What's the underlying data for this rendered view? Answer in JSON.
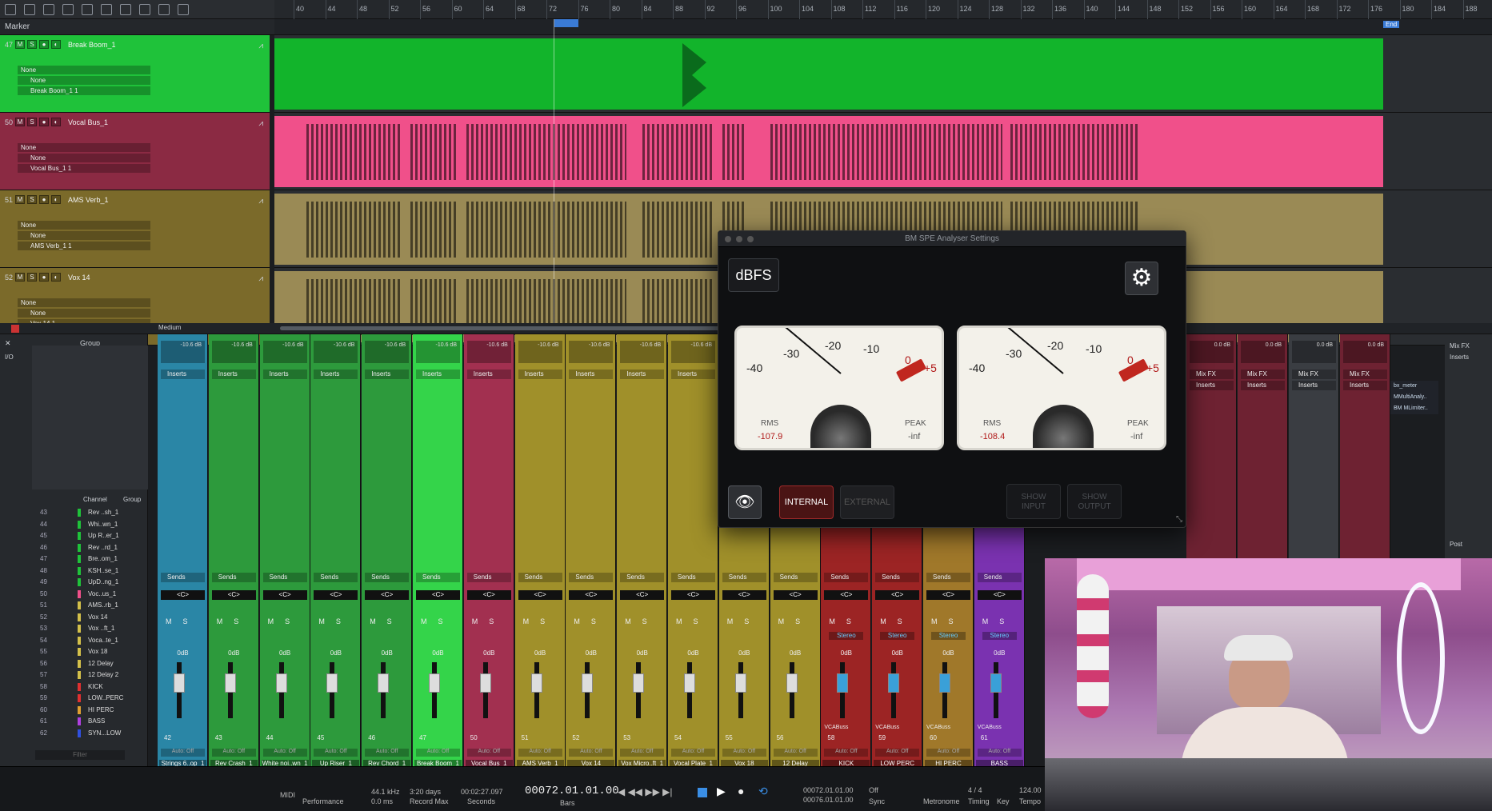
{
  "marker_label": "Marker",
  "ruler_ticks": [
    "40",
    "44",
    "48",
    "52",
    "56",
    "60",
    "64",
    "68",
    "72",
    "76",
    "80",
    "84",
    "88",
    "92",
    "96",
    "100",
    "104",
    "108",
    "112",
    "116",
    "120",
    "124",
    "128",
    "132",
    "136",
    "140",
    "144",
    "148",
    "152",
    "156",
    "160",
    "164",
    "168",
    "172",
    "176",
    "180",
    "184",
    "188"
  ],
  "end_label": "End",
  "tracks": [
    {
      "num": "47",
      "name": "Break Boom_1",
      "f1": "None",
      "f2": "None",
      "f3": "Break Boom_1 1",
      "color": "#1fc23a",
      "lane": "#12b42b"
    },
    {
      "num": "50",
      "name": "Vocal Bus_1",
      "f1": "None",
      "f2": "None",
      "f3": "Vocal Bus_1 1",
      "color": "#8b2a43",
      "lane": "#f0508a"
    },
    {
      "num": "51",
      "name": "AMS Verb_1",
      "f1": "None",
      "f2": "None",
      "f3": "AMS Verb_1 1",
      "color": "#7b6a2a",
      "lane": "#9a8a55"
    },
    {
      "num": "52",
      "name": "Vox 14",
      "f1": "None",
      "f2": "None",
      "f3": "Vox 14 1",
      "color": "#7b6a2a",
      "lane": "#9a8a55"
    }
  ],
  "zoom_label": "Medium",
  "analyser": {
    "title": "BM SPE Analyser Settings",
    "unit_button": "dBFS",
    "scale": [
      "-40",
      "-30",
      "-20",
      "-10",
      "0",
      "+5"
    ],
    "left_meter": {
      "rms_label": "RMS",
      "rms_value": "-107.9",
      "peak_label": "PEAK",
      "peak_value": "-inf"
    },
    "right_meter": {
      "rms_label": "RMS",
      "rms_value": "-108.4",
      "peak_label": "PEAK",
      "peak_value": "-inf"
    },
    "internal": "INTERNAL",
    "external": "EXTERNAL",
    "show_input_1": "SHOW",
    "show_input_2": "INPUT",
    "show_output_1": "SHOW",
    "show_output_2": "OUTPUT"
  },
  "mixer": {
    "group_label": "Group",
    "io_label": "I/O",
    "channel_col": "Channel",
    "group_col": "Group",
    "filter": "Filter",
    "channels": [
      {
        "n": "43",
        "name": "Rev ..sh_1",
        "c": "#1fc23a"
      },
      {
        "n": "44",
        "name": "Whi..wn_1",
        "c": "#1fc23a"
      },
      {
        "n": "45",
        "name": "Up R..er_1",
        "c": "#1fc23a"
      },
      {
        "n": "46",
        "name": "Rev ..rd_1",
        "c": "#1fc23a"
      },
      {
        "n": "47",
        "name": "Bre..om_1",
        "c": "#1fc23a"
      },
      {
        "n": "48",
        "name": "KSH..se_1",
        "c": "#1fc23a"
      },
      {
        "n": "49",
        "name": "UpD..ng_1",
        "c": "#1fc23a"
      },
      {
        "n": "50",
        "name": "Voc..us_1",
        "c": "#f0508a"
      },
      {
        "n": "51",
        "name": "AMS..rb_1",
        "c": "#d4c04a"
      },
      {
        "n": "52",
        "name": "Vox 14",
        "c": "#d4c04a"
      },
      {
        "n": "53",
        "name": "Vox ..ft_1",
        "c": "#d4c04a"
      },
      {
        "n": "54",
        "name": "Voca..te_1",
        "c": "#d4c04a"
      },
      {
        "n": "55",
        "name": "Vox 18",
        "c": "#d4c04a"
      },
      {
        "n": "56",
        "name": "12 Delay",
        "c": "#d4c04a"
      },
      {
        "n": "57",
        "name": "12 Delay 2",
        "c": "#d4c04a"
      },
      {
        "n": "58",
        "name": "KICK",
        "c": "#e03030"
      },
      {
        "n": "59",
        "name": "LOW..PERC",
        "c": "#e03030"
      },
      {
        "n": "60",
        "name": "HI PERC",
        "c": "#e0a030"
      },
      {
        "n": "61",
        "name": "BASS",
        "c": "#b040e0"
      },
      {
        "n": "62",
        "name": "SYN...LOW",
        "c": "#3050e0"
      }
    ],
    "strips": [
      {
        "name": "Strings 6..op_1",
        "num": "42",
        "bg": "#2a86a6",
        "db": "-10.6 dB",
        "v": "0dB"
      },
      {
        "name": "Rev Crash_1",
        "num": "43",
        "bg": "#2d9a3c",
        "db": "-10.6 dB",
        "v": "0dB"
      },
      {
        "name": "White noi..wn_1",
        "num": "44",
        "bg": "#2d9a3c",
        "db": "-10.6 dB",
        "v": "0dB"
      },
      {
        "name": "Up Riser_1",
        "num": "45",
        "bg": "#2d9a3c",
        "db": "-10.6 dB",
        "v": "0dB"
      },
      {
        "name": "Rev Chord_1",
        "num": "46",
        "bg": "#2d9a3c",
        "db": "-10.6 dB",
        "v": "0dB"
      },
      {
        "name": "Break Boom_1",
        "num": "47",
        "bg": "#34d44a",
        "db": "-10.6 dB",
        "v": "0dB"
      },
      {
        "name": "Vocal Bus_1",
        "num": "50",
        "bg": "#a23050",
        "db": "-10.6 dB",
        "v": "0dB"
      },
      {
        "name": "AMS Verb_1",
        "num": "51",
        "bg": "#a0902a",
        "db": "-10.6 dB",
        "v": "0dB"
      },
      {
        "name": "Vox 14",
        "num": "52",
        "bg": "#a0902a",
        "db": "-10.6 dB",
        "v": "0dB"
      },
      {
        "name": "Vox Micro..ft_1",
        "num": "53",
        "bg": "#a0902a",
        "db": "-10.6 dB",
        "v": "0dB"
      },
      {
        "name": "Vocal Plate_1",
        "num": "54",
        "bg": "#a0902a",
        "db": "-10.6 dB",
        "v": "0dB"
      },
      {
        "name": "Vox 18",
        "num": "55",
        "bg": "#a0902a",
        "db": "",
        "v": "0dB"
      },
      {
        "name": "12 Delay",
        "num": "56",
        "bg": "#a0902a",
        "db": "",
        "v": "0dB"
      },
      {
        "name": "KICK",
        "num": "58",
        "bg": "#9c2424",
        "db": "",
        "v": "0dB"
      },
      {
        "name": "LOW PERC",
        "num": "59",
        "bg": "#9c2424",
        "db": "",
        "v": "0dB"
      },
      {
        "name": "HI PERC",
        "num": "60",
        "bg": "#a0782a",
        "db": "",
        "v": "0dB"
      },
      {
        "name": "BASS",
        "num": "61",
        "bg": "#7a32b0",
        "db": "",
        "v": "0dB"
      }
    ],
    "inserts": "Inserts",
    "sends": "Sends",
    "pan": "<C>",
    "auto_off": "Auto: Off",
    "stereo": "Stereo",
    "vcabuss": "VCABuss",
    "right_strips": [
      {
        "db": "0.0 dB",
        "fx": "Mix FX"
      },
      {
        "db": "0.0 dB",
        "fx": "Mix FX"
      },
      {
        "db": "0.0 dB",
        "fx": "Mix FX"
      },
      {
        "db": "0.0 dB",
        "fx": "Mix FX"
      }
    ],
    "plugins": [
      "bx_meter",
      "MMultiAnaly..",
      "BM MLimiter.."
    ],
    "post": "Post"
  },
  "transport": {
    "midi": "MIDI",
    "performance": "Performance",
    "rate": "44.1 kHz",
    "rate_sub": "0.0 ms",
    "days": "3:20 days",
    "record_max": "Record Max",
    "seconds": "00:02:27.097",
    "seconds_label": "Seconds",
    "bars": "00072.01.01.00",
    "bars_label": "Bars",
    "loop_l": "00072.01.01.00",
    "loop_r": "00076.01.01.00",
    "sync": "Sync",
    "off": "Off",
    "metronome": "Metronome",
    "timing": "4 / 4",
    "timing_label": "Timing",
    "key_label": "Key",
    "tempo": "124.00",
    "tempo_label": "Tempo"
  }
}
